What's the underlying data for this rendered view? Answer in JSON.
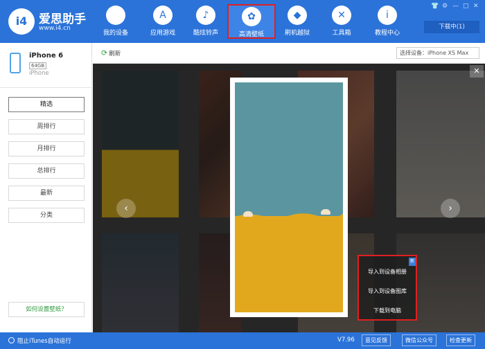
{
  "app": {
    "logo_mark": "i4",
    "name": "爱思助手",
    "url": "www.i4.cn"
  },
  "nav": {
    "items": [
      {
        "label": "我的设备",
        "icon": "apple-icon"
      },
      {
        "label": "应用游戏",
        "icon": "app-store-icon"
      },
      {
        "label": "酷炫铃声",
        "icon": "bell-icon"
      },
      {
        "label": "高清壁纸",
        "icon": "wallpaper-icon",
        "active": true
      },
      {
        "label": "刷机越狱",
        "icon": "dropbox-icon"
      },
      {
        "label": "工具箱",
        "icon": "tools-icon"
      },
      {
        "label": "教程中心",
        "icon": "info-icon"
      }
    ],
    "download": "下载中(1)"
  },
  "device": {
    "name": "iPhone 6",
    "capacity": "64GB",
    "os": "iPhone"
  },
  "sidebar": {
    "items": [
      "精选",
      "周排行",
      "月排行",
      "总排行",
      "最新",
      "分类"
    ],
    "howto": "如何设置壁纸？"
  },
  "toolbar": {
    "refresh": "刷新",
    "device_select": "选择设备：iPhone XS Max"
  },
  "actions": {
    "items": [
      "导入到设备相册",
      "导入到设备图库",
      "下载到电脑"
    ]
  },
  "status": {
    "itunes": "阻止iTunes自动运行",
    "version": "V7.96",
    "feedback": "意见反馈",
    "wechat": "微信公众号",
    "update": "检查更新"
  },
  "colors": {
    "brand_blue": "#2b73d9",
    "highlight_red": "#e02020",
    "sand_yellow": "#e2a81d",
    "sky_teal": "#5b96a0"
  }
}
